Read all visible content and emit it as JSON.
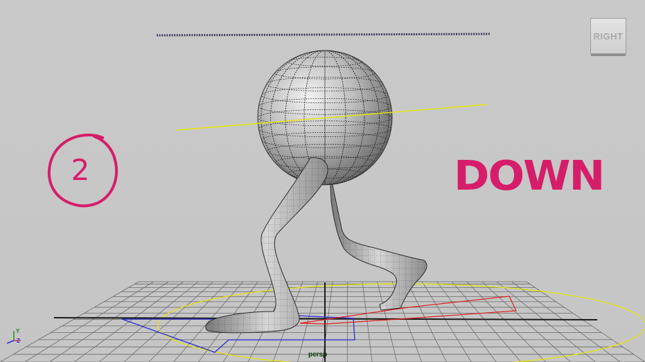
{
  "viewport": {
    "view_cube_label": "RIGHT",
    "camera_name": "persp",
    "axis_y": "Y",
    "axis_z": "Z"
  },
  "annotations": {
    "pose_number": "2",
    "pose_name": "DOWN"
  },
  "colors": {
    "background": "#c8c8c8",
    "annotation": "#d61d6a",
    "grid": "#555555",
    "guide_line": "#e6e600",
    "blue_rect": "#2a2ad8",
    "red_rect": "#e01e1e"
  },
  "icons": [
    "view-cube-icon",
    "axis-indicator-icon"
  ]
}
